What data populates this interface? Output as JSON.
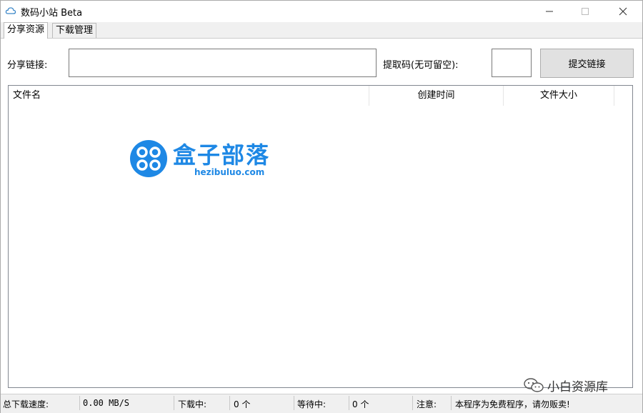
{
  "window": {
    "title": "数码小站 Beta",
    "icons": {
      "app": "cloud-icon",
      "minimize": "minimize-icon",
      "maximize": "maximize-icon",
      "close": "close-icon"
    }
  },
  "tabs": [
    {
      "label": "分享资源",
      "active": true
    },
    {
      "label": "下载管理",
      "active": false
    }
  ],
  "form": {
    "share_link_label": "分享链接:",
    "share_link_value": "",
    "code_label": "提取码(无可留空):",
    "code_value": "",
    "submit_label": "提交链接"
  },
  "list": {
    "columns": [
      "文件名",
      "创建时间",
      "文件大小"
    ],
    "rows": []
  },
  "watermark": {
    "title": "盒子部落",
    "url": "hezibuluo.com",
    "color": "#1e88e5"
  },
  "status": {
    "speed_label": "总下载速度:",
    "speed_value": "0.00 MB/S",
    "downloading_label": "下载中:",
    "downloading_value": "0 个",
    "waiting_label": "等待中:",
    "waiting_value": "0 个",
    "notice_label": "注意:",
    "notice_text": "本程序为免费程序，请勿贩卖!"
  },
  "overlay": {
    "text": "小白资源库",
    "icon": "wechat-icon"
  }
}
